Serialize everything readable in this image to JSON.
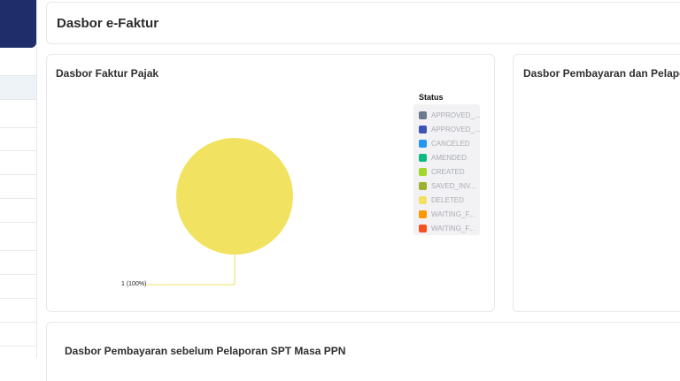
{
  "header": {
    "title": "Dasbor e-Faktur"
  },
  "faktur_card": {
    "title": "Dasbor Faktur Pajak",
    "legend_title": "Status",
    "slice_label": "1 (100%)"
  },
  "pembayaran_card": {
    "title": "Dasbor Pembayaran dan Pelapo"
  },
  "bottom_card": {
    "title": "Dasbor Pembayaran sebelum Pelaporan SPT Masa PPN"
  },
  "chart_data": {
    "type": "pie",
    "title": "Dasbor Faktur Pajak",
    "legend_title": "Status",
    "legend_placement": "right",
    "categories": [
      "APPROVED_...",
      "APPROVED_...",
      "CANCELED",
      "AMENDED",
      "CREATED",
      "SAVED_INV...",
      "DELETED",
      "WAITING_F...",
      "WAITING_F..."
    ],
    "colors": [
      "#6b7a8f",
      "#3f51b5",
      "#2196f3",
      "#10b981",
      "#a3d62a",
      "#9fb02c",
      "#f2e262",
      "#ff9800",
      "#f4511e"
    ],
    "values": [
      0,
      0,
      0,
      0,
      0,
      0,
      1,
      0,
      0
    ],
    "data_labels": [
      "",
      "",
      "",
      "",
      "",
      "",
      "1 (100%)",
      "",
      ""
    ]
  }
}
